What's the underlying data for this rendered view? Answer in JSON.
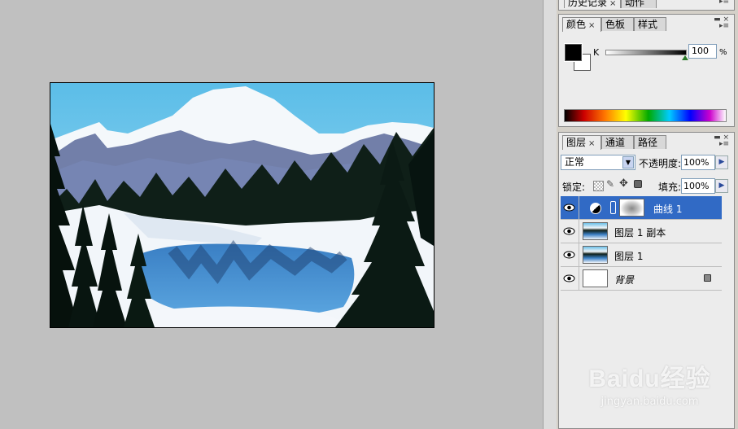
{
  "history_panel": {
    "tabs": [
      "历史记录",
      "动作"
    ]
  },
  "color_panel": {
    "tabs": [
      "颜色",
      "色板",
      "样式"
    ],
    "channel_label": "K",
    "value": "100",
    "unit": "%",
    "slider_level": 1.0,
    "fg_color": "#000000",
    "bg_color": "#ffffff"
  },
  "layers_panel": {
    "tabs": [
      "图层",
      "通道",
      "路径"
    ],
    "blend_mode": "正常",
    "opacity_label": "不透明度:",
    "opacity_value": "100%",
    "lock_label": "锁定:",
    "fill_label": "填充:",
    "fill_value": "100%",
    "layers": [
      {
        "name": "曲线 1",
        "selected": true
      },
      {
        "name": "图层 1 副本",
        "selected": false
      },
      {
        "name": "图层 1",
        "selected": false
      },
      {
        "name": "背景",
        "selected": false
      }
    ]
  },
  "watermark": {
    "line1": "Baidu经验",
    "line2": "jingyan.baidu.com"
  },
  "colors": {
    "selection": "#316ac5",
    "canvas": "#c0c0c0",
    "panel": "#ececec"
  }
}
